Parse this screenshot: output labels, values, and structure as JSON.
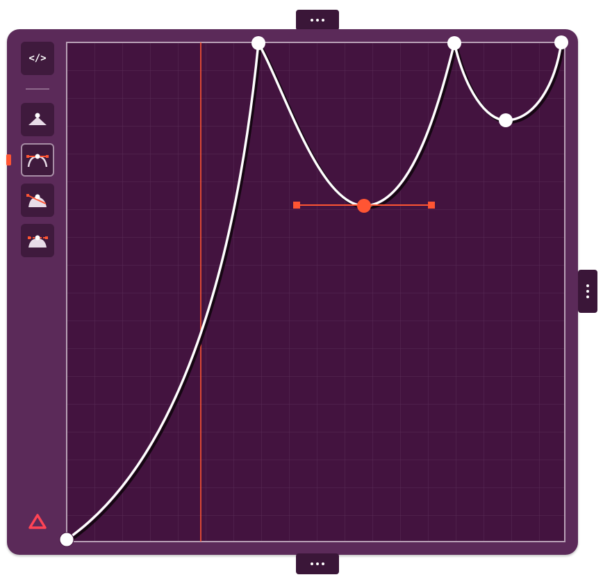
{
  "toolbar": {
    "code_button_label": "</>",
    "tools": [
      {
        "icon": "curve-point-icon"
      },
      {
        "icon": "bezier-handles-icon"
      },
      {
        "icon": "tangent-handle-icon"
      },
      {
        "icon": "bezier-smooth-icon"
      }
    ],
    "active_tool_index": 1,
    "logo_icon": "triangle-logo-icon"
  },
  "tabs": {
    "top": "more-options-top",
    "bottom": "more-options-bottom",
    "right": "more-options-right"
  },
  "editor": {
    "grid_divisions": 18,
    "playhead_position": 0.27,
    "keyframes": [
      {
        "t": 0.0,
        "v": 0.0
      },
      {
        "t": 0.385,
        "v": 1.0
      },
      {
        "t": 0.597,
        "v": 0.67
      },
      {
        "t": 0.78,
        "v": 1.0
      },
      {
        "t": 0.884,
        "v": 0.845
      },
      {
        "t": 1.0,
        "v": 1.0
      }
    ],
    "selected_keyframe_index": 2,
    "colors": {
      "panel": "#5b2a59",
      "canvas": "#43133f",
      "grid": "#5a2c57",
      "curve": "#ffffff",
      "accent": "#ff5533",
      "toolbar_button": "#3f1a3d"
    }
  }
}
